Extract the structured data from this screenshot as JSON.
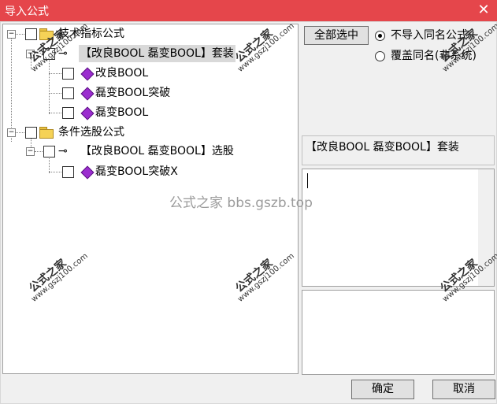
{
  "window": {
    "title": "导入公式",
    "close_symbol": "✕"
  },
  "tree": {
    "nodes": [
      {
        "label": "技术指标公式",
        "expander": "−"
      },
      {
        "label": "【改良BOOL 磊变BOOL】套装",
        "expander": "−"
      },
      {
        "label": "改良BOOL"
      },
      {
        "label": "磊变BOOL突破"
      },
      {
        "label": "磊变BOOL"
      },
      {
        "label": "条件选股公式",
        "expander": "−"
      },
      {
        "label": "【改良BOOL 磊变BOOL】选股",
        "expander": "−"
      },
      {
        "label": "磊变BOOL突破X"
      }
    ]
  },
  "select_all_label": "全部选中",
  "options": [
    {
      "label": "不导入同名公式",
      "checked": true
    },
    {
      "label": "覆盖同名(非系统)",
      "checked": false
    }
  ],
  "selected_name": "【改良BOOL 磊变BOOL】套装",
  "buttons": {
    "ok": "确定",
    "cancel": "取消"
  },
  "watermark_center": "公式之家 bbs.gszb.top",
  "stamp": {
    "title": "公式之家",
    "url": "www.gszj100.com"
  }
}
